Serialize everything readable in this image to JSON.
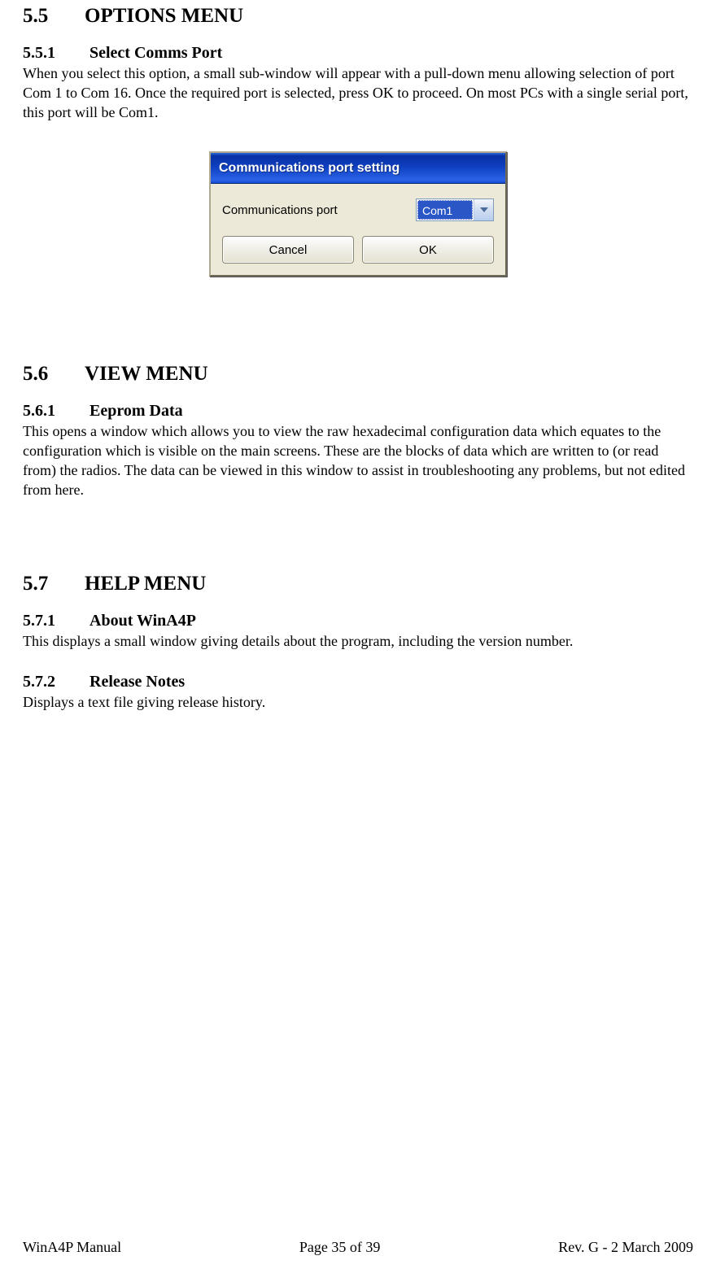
{
  "sections": {
    "s55": {
      "num": "5.5",
      "title": "OPTIONS MENU"
    },
    "s551": {
      "num": "5.5.1",
      "title": "Select Comms Port",
      "body": "When you select this option, a small sub-window will appear with a pull-down menu allowing selection of port Com 1 to Com 16.  Once the required port is selected, press OK to proceed.  On most PCs with a single serial port, this port will be Com1."
    },
    "s56": {
      "num": "5.6",
      "title": "VIEW MENU"
    },
    "s561": {
      "num": "5.6.1",
      "title": "Eeprom Data",
      "body": "This opens a window which allows you to view the raw hexadecimal configuration data which equates to the configuration which is visible on the main screens.  These are the blocks of data which are written to (or read from) the radios.  The data can be viewed in this window to assist in troubleshooting any problems, but not edited from here."
    },
    "s57": {
      "num": "5.7",
      "title": "HELP MENU"
    },
    "s571": {
      "num": "5.7.1",
      "title": "About WinA4P",
      "body": "This displays a small window giving details about the program, including the version number."
    },
    "s572": {
      "num": "5.7.2",
      "title": "Release Notes",
      "body": "Displays a text file giving release history."
    }
  },
  "dialog": {
    "title": "Communications port setting",
    "label": "Communications port",
    "value": "Com1",
    "cancel": "Cancel",
    "ok": "OK"
  },
  "footer": {
    "left": "WinA4P Manual",
    "center": "Page 35 of 39",
    "right": "Rev. G -  2 March 2009"
  }
}
